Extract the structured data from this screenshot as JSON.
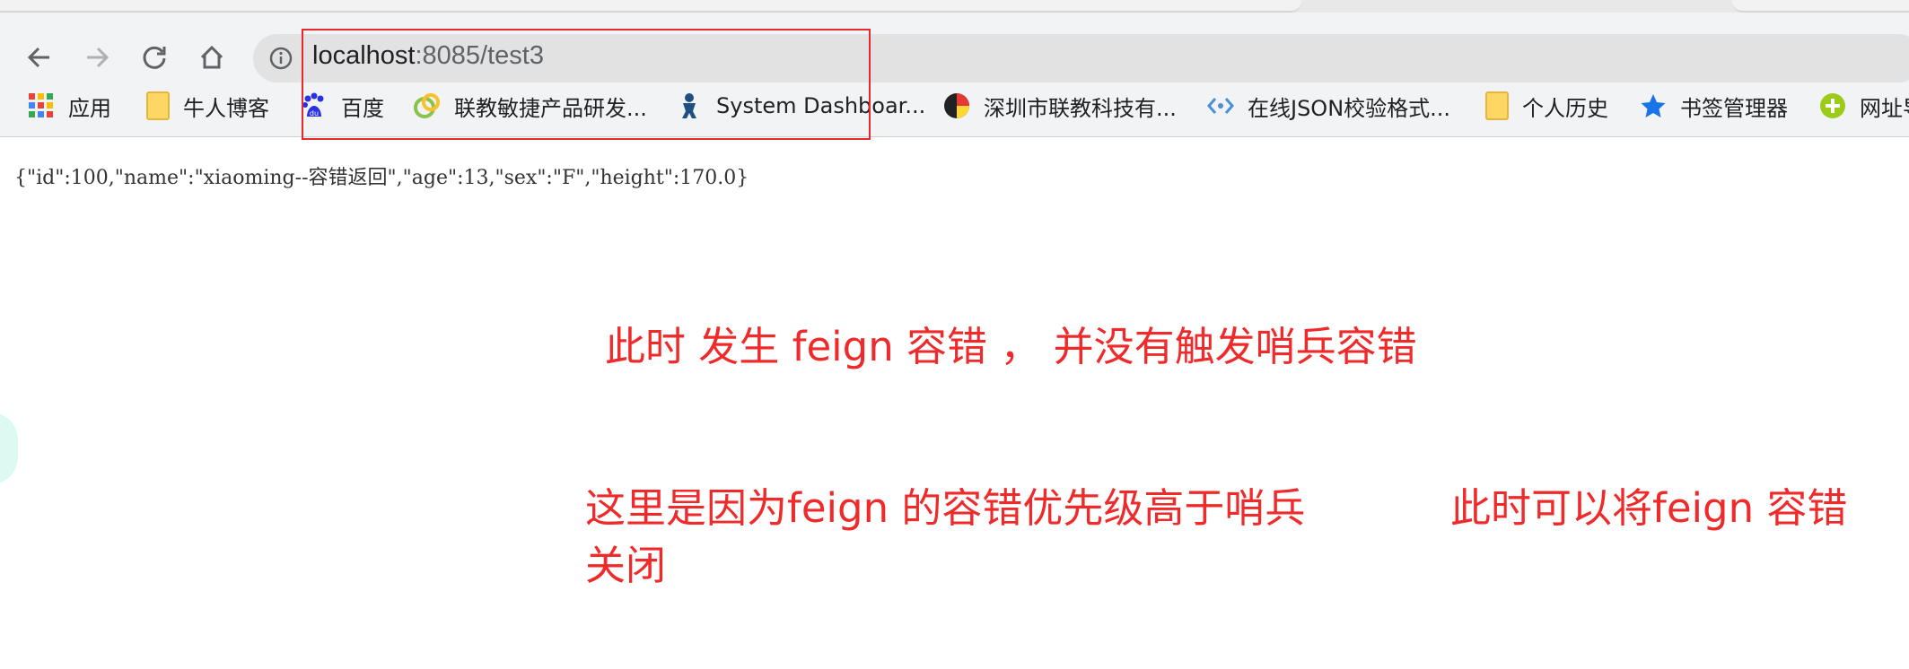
{
  "browser": {
    "address": {
      "host": "localhost",
      "path": ":8085/test3"
    }
  },
  "bookmarks": [
    {
      "label": "应用",
      "icon": "apps-grid-icon"
    },
    {
      "label": "牛人博客",
      "icon": "folder-icon"
    },
    {
      "label": "百度",
      "icon": "baidu-icon"
    },
    {
      "label": "联教敏捷产品研发...",
      "icon": "globe-icon"
    },
    {
      "label": "System Dashboar...",
      "icon": "jira-icon"
    },
    {
      "label": "深圳市联教科技有...",
      "icon": "site-logo-icon"
    },
    {
      "label": "在线JSON校验格式...",
      "icon": "json-icon"
    },
    {
      "label": "个人历史",
      "icon": "folder-icon"
    },
    {
      "label": "书签管理器",
      "icon": "star-icon"
    },
    {
      "label": "网址导",
      "icon": "plus-circle-icon"
    }
  ],
  "page": {
    "json_text": "{\"id\":100,\"name\":\"xiaoming--容错返回\",\"age\":13,\"sex\":\"F\",\"height\":170.0}"
  },
  "annotations": {
    "line1": "此时 发生 feign  容错 ， 并没有触发哨兵容错",
    "line2a": "这里是因为feign 的容错优先级高于哨兵",
    "line2b": "关闭",
    "line3": "此时可以将feign 容错"
  },
  "colors": {
    "annotation": "#ef2a2a",
    "highlight_box": "#e8282a"
  }
}
